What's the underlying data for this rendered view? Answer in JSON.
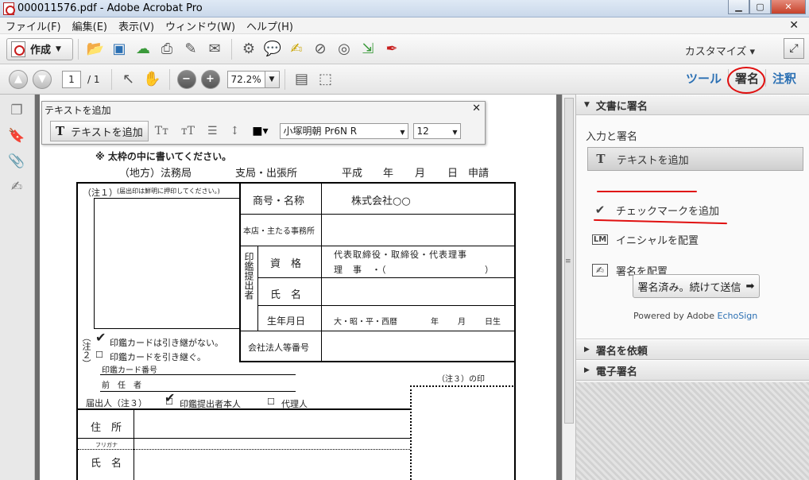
{
  "window": {
    "title": "000011576.pdf - Adobe Acrobat Pro"
  },
  "menu": [
    "ファイル(F)",
    "編集(E)",
    "表示(V)",
    "ウィンドウ(W)",
    "ヘルプ(H)"
  ],
  "toolbar": {
    "create_label": "作成",
    "customize_label": "カスタマイズ"
  },
  "nav": {
    "page_current": "1",
    "page_total": "/ 1",
    "zoom": "72.2%"
  },
  "tabs": {
    "tools": "ツール",
    "sign": "署名",
    "comment": "注釈"
  },
  "float_toolbar": {
    "title": "テキストを追加",
    "button": "テキストを追加",
    "font": "小塚明朝 Pr6N R",
    "size": "12"
  },
  "panel": {
    "section_sign_doc": "文書に署名",
    "input_sign": "入力と署名",
    "items": [
      "テキストを追加",
      "チェックマークを追加",
      "イニシャルを配置",
      "署名を配置"
    ],
    "send_button": "署名済み。続けて送信",
    "powered": "Powered by Adobe ",
    "echosign": "EchoSign",
    "section_request": "署名を依頼",
    "section_esign": "電子署名"
  },
  "form": {
    "note": "※ 太枠の中に書いてください。",
    "header": [
      "（地方）法務局",
      "支局・出張所",
      "平成",
      "年",
      "月",
      "日",
      "申請"
    ],
    "note1": "（注１）",
    "note1_small": "(届出印は鮮明に押印してください。)",
    "shogo": "商号・名称",
    "company": "株式会社○○",
    "honten": "本店・主たる事務所",
    "inkan": "印鑑提出者",
    "shikaku": "資　格",
    "shikaku_val1": "代表取締役・取締役・代表理事",
    "shikaku_val2": "理　事　・（",
    "shimei": "氏　名",
    "seinen": "生年月日",
    "seinen_val": "大・昭・平・西暦",
    "nen": "年",
    "tsuki": "月",
    "umare": "日生",
    "kaisha_no": "会社法人等番号",
    "chu2": "（注２）",
    "card1": "印鑑カードは引き継がない。",
    "card2": "印鑑カードを引き継ぐ。",
    "card_no": "印鑑カード番号",
    "zennin": "前　任　者",
    "chu3_in": "（注３）の印",
    "todoke": "届出人（注３）",
    "honnin": "印鑑提出者本人",
    "dairi": "代理人",
    "jusho": "住　所",
    "furigana": "フリガナ",
    "shimei2": "氏　名"
  }
}
